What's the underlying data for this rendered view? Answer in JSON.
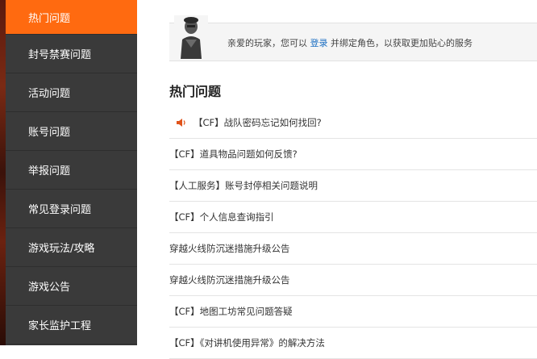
{
  "sidebar": {
    "items": [
      {
        "label": "热门问题",
        "active": true
      },
      {
        "label": "封号禁赛问题"
      },
      {
        "label": "活动问题"
      },
      {
        "label": "账号问题"
      },
      {
        "label": "举报问题"
      },
      {
        "label": "常见登录问题"
      },
      {
        "label": "游戏玩法/攻略"
      },
      {
        "label": "游戏公告"
      },
      {
        "label": "家长监护工程"
      }
    ],
    "active_color": "#ff6a10",
    "background_color": "#3a3a3a"
  },
  "banner": {
    "text_before": "亲爱的玩家，您可以 ",
    "link": "登录",
    "text_after": " 并绑定角色，以获取更加贴心的服务",
    "link_color": "#1a6ec2"
  },
  "section": {
    "title": "热门问题"
  },
  "questions": [
    {
      "text": "【CF】战队密码忘记如何找回?",
      "icon": "speaker-icon"
    },
    {
      "text": "【CF】道具物品问题如何反馈?"
    },
    {
      "text": "【人工服务】账号封停相关问题说明"
    },
    {
      "text": "【CF】个人信息查询指引"
    },
    {
      "text": "穿越火线防沉迷措施升级公告"
    },
    {
      "text": "穿越火线防沉迷措施升级公告"
    },
    {
      "text": "【CF】地图工坊常见问题答疑"
    },
    {
      "text": "【CF】《对讲机使用异常》的解决方法"
    }
  ]
}
